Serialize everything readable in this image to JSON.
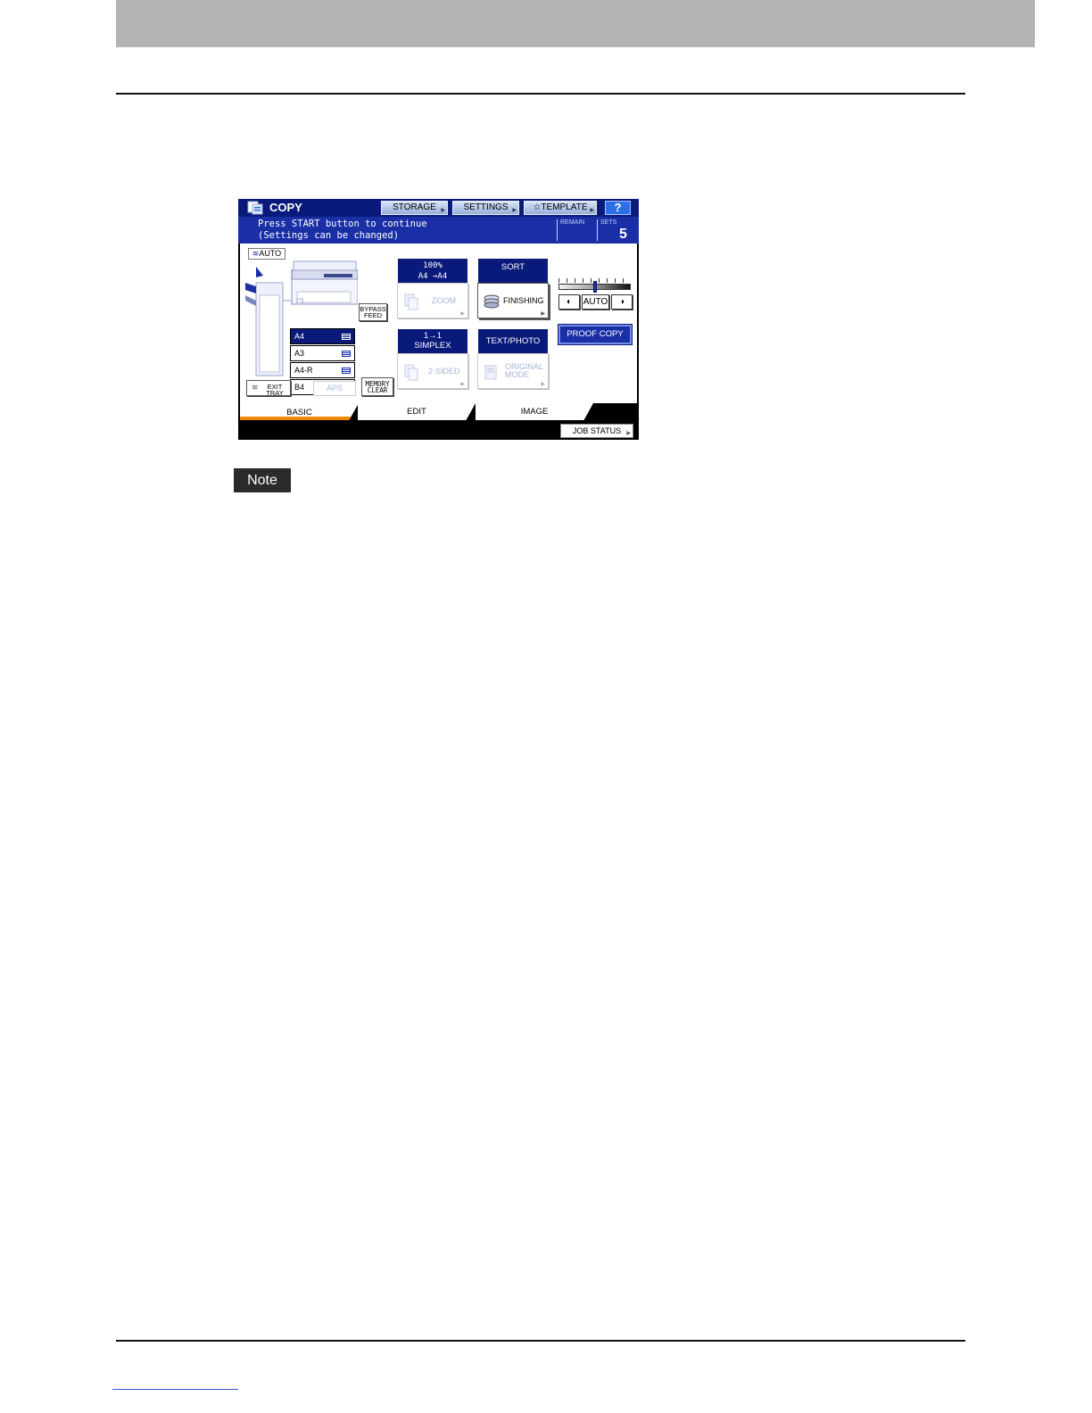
{
  "copy_panel": {
    "title": "COPY",
    "header_buttons": {
      "storage": "STORAGE",
      "settings": "SETTINGS",
      "template": "TEMPLATE",
      "help": "?"
    },
    "message": {
      "line1": "Press START button to continue",
      "line2": "(Settings can be changed)"
    },
    "remain_label": "REMAIN",
    "sets_label": "SETS",
    "sets_value": "5",
    "auto_label": "AUTO",
    "bypass_feed": {
      "line1": "BYPASS",
      "line2": "FEED"
    },
    "paper_trays": [
      {
        "label": "A4",
        "selected": true
      },
      {
        "label": "A3",
        "selected": false
      },
      {
        "label": "A4-R",
        "selected": false
      },
      {
        "label": "B4",
        "selected": false
      }
    ],
    "exit_tray": {
      "line1": "EXIT",
      "line2": "TRAY"
    },
    "aps_label": "APS",
    "memory_clear": {
      "line1": "MEMORY",
      "line2": "CLEAR"
    },
    "zoom": {
      "ratio": "100%",
      "paper": "A4  →A4",
      "button": "ZOOM"
    },
    "finishing": {
      "status": "SORT",
      "button": "FINISHING"
    },
    "two_sided": {
      "status_line1": "1→1",
      "status_line2": "SIMPLEX",
      "button": "2-SIDED"
    },
    "original_mode": {
      "status": "TEXT/PHOTO",
      "button_line1": "ORIGINAL",
      "button_line2": "MODE"
    },
    "density": {
      "auto_label": "AUTO",
      "level": 0.5
    },
    "proof_copy": "PROOF COPY",
    "tabs": {
      "basic": "BASIC",
      "edit": "EDIT",
      "image": "IMAGE"
    },
    "job_status": "JOB STATUS"
  },
  "note_label": "Note",
  "colors": {
    "header_navy": "#0a1a7a",
    "message_blue": "#1a2fa5",
    "active_tab_accent": "#f08a00",
    "top_band_gray": "#b3b3b3",
    "note_badge": "#2b2b2b"
  }
}
